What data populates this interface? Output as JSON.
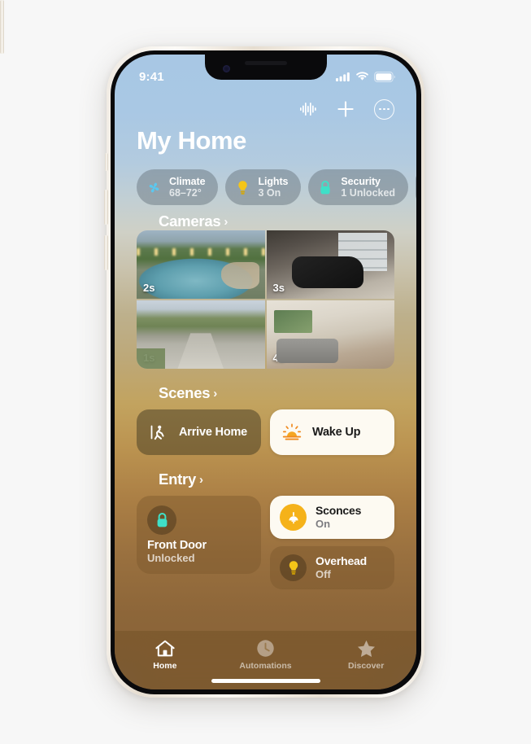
{
  "device": {
    "status_bar": {
      "time": "9:41",
      "icons": [
        "cellular-icon",
        "wifi-icon",
        "battery-icon"
      ]
    }
  },
  "header": {
    "title": "My Home",
    "actions": [
      {
        "name": "audio-waveform-icon",
        "label": "Audio"
      },
      {
        "name": "plus-icon",
        "label": "Add"
      },
      {
        "name": "more-ellipsis-icon",
        "label": "More"
      }
    ]
  },
  "status_chips": [
    {
      "icon": "fan-icon",
      "title": "Climate",
      "subtitle": "68–72°",
      "accent": "#5ac8f0"
    },
    {
      "icon": "bulb-icon",
      "title": "Lights",
      "subtitle": "3 On",
      "accent": "#f5c518"
    },
    {
      "icon": "lock-icon",
      "title": "Security",
      "subtitle": "1 Unlocked",
      "accent": "#3fe0c8"
    }
  ],
  "sections": {
    "cameras": {
      "title": "Cameras",
      "chevron": "›",
      "tiles": [
        {
          "name": "camera-pool",
          "badge": "2s",
          "art": "art-pool"
        },
        {
          "name": "camera-garage",
          "badge": "3s",
          "art": "art-garage"
        },
        {
          "name": "camera-driveway",
          "badge": "1s",
          "art": "art-street"
        },
        {
          "name": "camera-livingroom",
          "badge": "4s",
          "art": "art-living"
        }
      ]
    },
    "scenes": {
      "title": "Scenes",
      "chevron": "›",
      "items": [
        {
          "name": "scene-arrive-home",
          "label": "Arrive Home",
          "icon": "walk-through-door-icon",
          "state": "off"
        },
        {
          "name": "scene-wake-up",
          "label": "Wake Up",
          "icon": "sunrise-icon",
          "state": "on"
        }
      ]
    },
    "entry": {
      "title": "Entry",
      "chevron": "›",
      "lock_tile": {
        "name": "Front Door",
        "subtitle": "Unlocked",
        "icon": "lock-icon",
        "state": "unlocked"
      },
      "accessories": [
        {
          "name": "Sconces",
          "state_label": "On",
          "icon": "sconce-lamp-icon",
          "state": "on"
        },
        {
          "name": "Overhead",
          "state_label": "Off",
          "icon": "bulb-icon",
          "state": "off"
        }
      ]
    }
  },
  "tabbar": [
    {
      "name": "tab-home",
      "label": "Home",
      "icon": "house-icon",
      "active": true
    },
    {
      "name": "tab-automations",
      "label": "Automations",
      "icon": "clock-icon",
      "active": false
    },
    {
      "name": "tab-discover",
      "label": "Discover",
      "icon": "star-icon",
      "active": false
    }
  ],
  "colors": {
    "accent_yellow": "#f5b21a",
    "accent_orange": "#f08a1e",
    "accent_teal": "#3fe0c8",
    "accent_blue": "#5ac8f0",
    "card_light": "#fdfaf2"
  }
}
